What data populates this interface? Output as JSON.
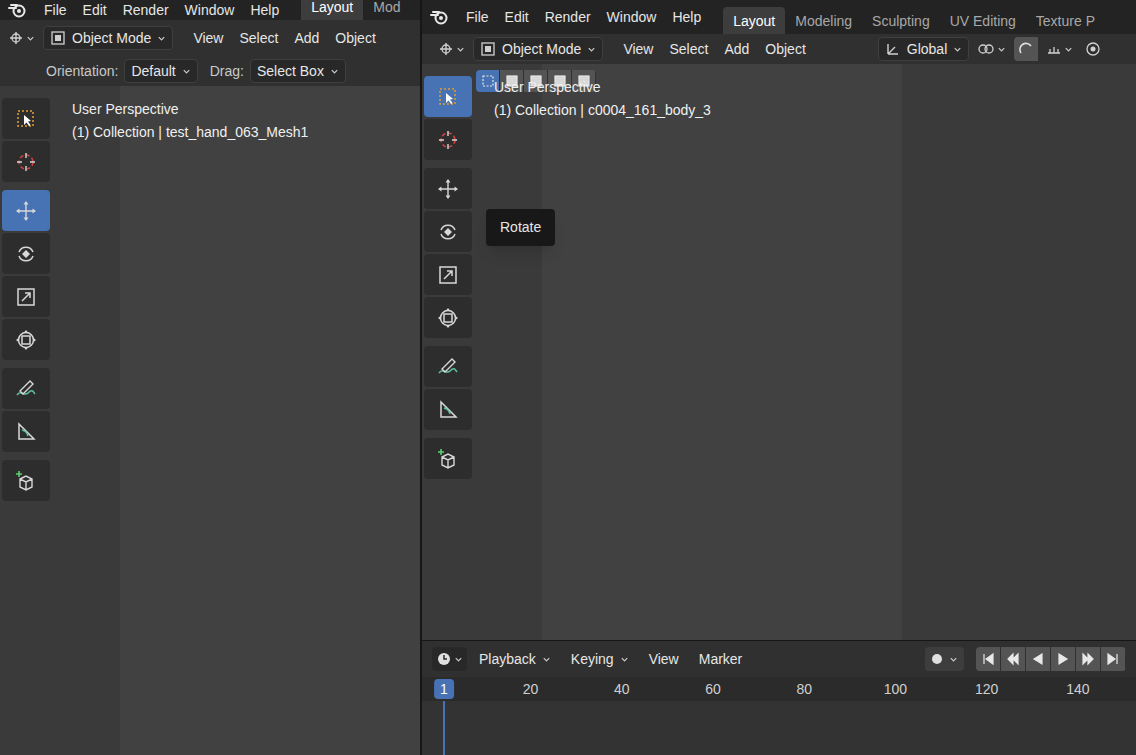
{
  "left_window": {
    "menus": [
      "File",
      "Edit",
      "Render",
      "Window",
      "Help"
    ],
    "tabs": [
      {
        "label": "Layout",
        "selected": true
      },
      {
        "label": "Mod",
        "selected": false
      }
    ],
    "mode": "Object Mode",
    "header_menus": [
      "View",
      "Select",
      "Add",
      "Object"
    ],
    "tool_settings": [
      {
        "label": "Orientation:",
        "value": "Default"
      },
      {
        "label": "Drag:",
        "value": "Select Box"
      }
    ],
    "tools": [
      {
        "kind": "select",
        "selected": false
      },
      {
        "kind": "cursor",
        "selected": false
      },
      {
        "kind": "move",
        "selected": true
      },
      {
        "kind": "rotate",
        "selected": false
      },
      {
        "kind": "scale",
        "selected": false
      },
      {
        "kind": "transform",
        "selected": false
      },
      {
        "kind": "annotate",
        "selected": false
      },
      {
        "kind": "measure",
        "selected": false
      },
      {
        "kind": "add",
        "selected": false
      }
    ],
    "overlay": [
      "User Perspective",
      "(1) Collection | test_hand_063_Mesh1"
    ]
  },
  "right_window": {
    "menus": [
      "File",
      "Edit",
      "Render",
      "Window",
      "Help"
    ],
    "tabs": [
      {
        "label": "Layout",
        "selected": true
      },
      {
        "label": "Modeling",
        "selected": false
      },
      {
        "label": "Sculpting",
        "selected": false
      },
      {
        "label": "UV Editing",
        "selected": false
      },
      {
        "label": "Texture P",
        "selected": false
      }
    ],
    "mode": "Object Mode",
    "header_menus": [
      "View",
      "Select",
      "Add",
      "Object"
    ],
    "orientation": "Global",
    "select_modes": [
      {
        "selected": true
      },
      {
        "selected": false
      },
      {
        "selected": false
      },
      {
        "selected": false
      },
      {
        "selected": false
      }
    ],
    "tools": [
      {
        "kind": "select",
        "selected": true
      },
      {
        "kind": "cursor",
        "selected": false
      },
      {
        "kind": "move",
        "selected": false
      },
      {
        "kind": "rotate",
        "selected": false
      },
      {
        "kind": "scale",
        "selected": false
      },
      {
        "kind": "transform",
        "selected": false
      },
      {
        "kind": "annotate",
        "selected": false
      },
      {
        "kind": "measure",
        "selected": false
      },
      {
        "kind": "add",
        "selected": false
      }
    ],
    "tooltip": "Rotate",
    "overlay": [
      "User Perspective",
      "(1) Collection | c0004_161_body_3"
    ],
    "timeline": {
      "menus": [
        "Playback",
        "Keying",
        "View",
        "Marker"
      ],
      "frames": [
        "1",
        "20",
        "40",
        "60",
        "80",
        "100",
        "120",
        "140"
      ],
      "current_frame": "1"
    }
  }
}
